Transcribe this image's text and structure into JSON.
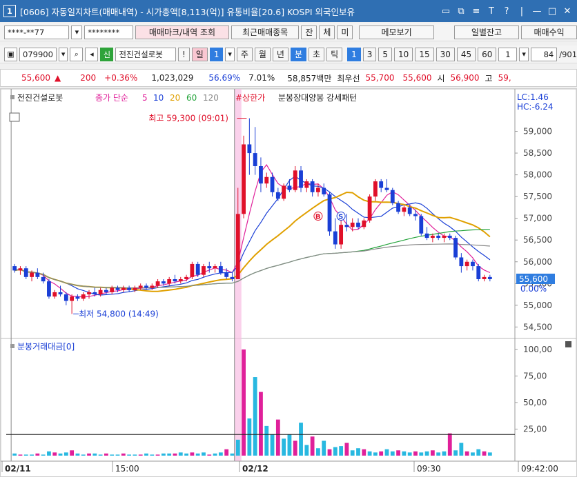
{
  "window": {
    "number": "1",
    "title": "[0606] 자동일지차트(매매내역) - 시가총액[8,113(억)] 유통비율[20.6] KOSPI 외국인보유",
    "controls": [
      "▭",
      "⧉",
      "≡",
      "T",
      "?",
      "|",
      "—",
      "□",
      "✕"
    ]
  },
  "toolbar1": {
    "account": "****-**77",
    "password": "********",
    "btn_trade_mark": "매매마크/내역 조회",
    "btn_recent": "최근매매종목",
    "btn_balance": "잔",
    "btn_fill": "체",
    "btn_unfilled": "미",
    "btn_memo": "메모보기",
    "btn_daily": "일별잔고",
    "btn_profit": "매매수익"
  },
  "toolbar2": {
    "code": "079900",
    "badge_new": "신",
    "stock_name": "전진건설로봇",
    "warn": "!",
    "day": "일",
    "day_count": "1",
    "periods": [
      "주",
      "월",
      "년"
    ],
    "minute": "분",
    "tick": "초",
    "tick2": "틱",
    "intervals": [
      "1",
      "3",
      "5",
      "10",
      "15",
      "30",
      "45",
      "60"
    ],
    "count_val": "1",
    "page_info": "84",
    "page_total": "/901"
  },
  "pricebar": {
    "price": "55,600",
    "arrow": "▲",
    "change": "200",
    "pct": "+0.36%",
    "volume": "1,023,029",
    "ratio1": "56.69%",
    "ratio2": "7.01%",
    "amount": "58,857백만",
    "best_label": "최우선",
    "ask": "55,700",
    "bid": "55,600",
    "open_label": "시",
    "open": "56,900",
    "high_label": "고",
    "high": "59,"
  },
  "chart_data": {
    "type": "candlestick",
    "legend": {
      "name": "전진건설로봇",
      "ma_label": "종가 단순",
      "ma_periods": [
        "5",
        "10",
        "20",
        "60",
        "120"
      ],
      "ma_colors": [
        "#e0209a",
        "#1a3fd6",
        "#e0a000",
        "#23a33a",
        "#888888"
      ],
      "limit_label": "#상한가",
      "pattern_label": "분봉장대양봉 강세패턴"
    },
    "lc": "LC:1.46",
    "hc": "HC:-6.24",
    "price_axis": [
      "59,000",
      "58,500",
      "58,000",
      "57,500",
      "57,000",
      "56,500",
      "56,000",
      "55,500",
      "55,000",
      "54,500"
    ],
    "current_price": "55,600",
    "current_pct": "0.00%",
    "high_note": "최고 59,300 (09:01)",
    "low_note": "최저 54,800 (14:49)",
    "candles": [
      {
        "o": 55900,
        "h": 55950,
        "l": 55750,
        "c": 55800
      },
      {
        "o": 55800,
        "h": 55900,
        "l": 55700,
        "c": 55850
      },
      {
        "o": 55850,
        "h": 55900,
        "l": 55600,
        "c": 55650
      },
      {
        "o": 55650,
        "h": 55800,
        "l": 55550,
        "c": 55750
      },
      {
        "o": 55750,
        "h": 55850,
        "l": 55600,
        "c": 55650
      },
      {
        "o": 55650,
        "h": 55750,
        "l": 55500,
        "c": 55550
      },
      {
        "o": 55550,
        "h": 55600,
        "l": 55150,
        "c": 55200
      },
      {
        "o": 55200,
        "h": 55350,
        "l": 55150,
        "c": 55300
      },
      {
        "o": 55300,
        "h": 55450,
        "l": 55200,
        "c": 55250
      },
      {
        "o": 55250,
        "h": 55300,
        "l": 55000,
        "c": 55100
      },
      {
        "o": 55100,
        "h": 55250,
        "l": 54800,
        "c": 55200
      },
      {
        "o": 55200,
        "h": 55250,
        "l": 55100,
        "c": 55150
      },
      {
        "o": 55150,
        "h": 55300,
        "l": 55100,
        "c": 55250
      },
      {
        "o": 55250,
        "h": 55350,
        "l": 55150,
        "c": 55300
      },
      {
        "o": 55300,
        "h": 55400,
        "l": 55200,
        "c": 55250
      },
      {
        "o": 55250,
        "h": 55400,
        "l": 55200,
        "c": 55350
      },
      {
        "o": 55350,
        "h": 55400,
        "l": 55250,
        "c": 55300
      },
      {
        "o": 55300,
        "h": 55450,
        "l": 55250,
        "c": 55400
      },
      {
        "o": 55400,
        "h": 55450,
        "l": 55300,
        "c": 55350
      },
      {
        "o": 55350,
        "h": 55450,
        "l": 55300,
        "c": 55400
      },
      {
        "o": 55400,
        "h": 55450,
        "l": 55300,
        "c": 55350
      },
      {
        "o": 55350,
        "h": 55450,
        "l": 55300,
        "c": 55400
      },
      {
        "o": 55400,
        "h": 55500,
        "l": 55350,
        "c": 55450
      },
      {
        "o": 55450,
        "h": 55500,
        "l": 55350,
        "c": 55400
      },
      {
        "o": 55400,
        "h": 55500,
        "l": 55350,
        "c": 55450
      },
      {
        "o": 55450,
        "h": 55600,
        "l": 55400,
        "c": 55550
      },
      {
        "o": 55550,
        "h": 55600,
        "l": 55450,
        "c": 55500
      },
      {
        "o": 55500,
        "h": 55650,
        "l": 55450,
        "c": 55600
      },
      {
        "o": 55600,
        "h": 55700,
        "l": 55500,
        "c": 55550
      },
      {
        "o": 55550,
        "h": 55650,
        "l": 55500,
        "c": 55600
      },
      {
        "o": 55600,
        "h": 55700,
        "l": 55550,
        "c": 55650
      },
      {
        "o": 55650,
        "h": 56000,
        "l": 55600,
        "c": 55950
      },
      {
        "o": 55950,
        "h": 56000,
        "l": 55650,
        "c": 55700
      },
      {
        "o": 55700,
        "h": 55950,
        "l": 55650,
        "c": 55900
      },
      {
        "o": 55900,
        "h": 56000,
        "l": 55750,
        "c": 55850
      },
      {
        "o": 55850,
        "h": 55950,
        "l": 55750,
        "c": 55900
      },
      {
        "o": 55900,
        "h": 56000,
        "l": 55700,
        "c": 55750
      },
      {
        "o": 55750,
        "h": 55850,
        "l": 55600,
        "c": 55650
      },
      {
        "o": 55650,
        "h": 55750,
        "l": 55550,
        "c": 55600
      },
      {
        "o": 55600,
        "h": 57700,
        "l": 55600,
        "c": 57100
      },
      {
        "o": 57100,
        "h": 58900,
        "l": 57000,
        "c": 58700
      },
      {
        "o": 58700,
        "h": 59300,
        "l": 58000,
        "c": 58500
      },
      {
        "o": 58500,
        "h": 59100,
        "l": 58000,
        "c": 58200
      },
      {
        "o": 58200,
        "h": 58400,
        "l": 57600,
        "c": 57800
      },
      {
        "o": 57800,
        "h": 58050,
        "l": 57700,
        "c": 57950
      },
      {
        "o": 57950,
        "h": 58050,
        "l": 57500,
        "c": 57600
      },
      {
        "o": 57600,
        "h": 57700,
        "l": 57400,
        "c": 57450
      },
      {
        "o": 57450,
        "h": 57800,
        "l": 57400,
        "c": 57750
      },
      {
        "o": 57750,
        "h": 57900,
        "l": 57600,
        "c": 57650
      },
      {
        "o": 57650,
        "h": 58200,
        "l": 57600,
        "c": 58100
      },
      {
        "o": 58100,
        "h": 58200,
        "l": 57600,
        "c": 57700
      },
      {
        "o": 57700,
        "h": 57900,
        "l": 57600,
        "c": 57850
      },
      {
        "o": 57850,
        "h": 57900,
        "l": 57500,
        "c": 57600
      },
      {
        "o": 57600,
        "h": 57800,
        "l": 57500,
        "c": 57700
      },
      {
        "o": 57700,
        "h": 57800,
        "l": 57500,
        "c": 57550
      },
      {
        "o": 57550,
        "h": 57600,
        "l": 56600,
        "c": 56700
      },
      {
        "o": 56700,
        "h": 57000,
        "l": 56300,
        "c": 56400
      },
      {
        "o": 56400,
        "h": 56950,
        "l": 56300,
        "c": 56850
      },
      {
        "o": 56850,
        "h": 57100,
        "l": 56700,
        "c": 56800
      },
      {
        "o": 56800,
        "h": 57000,
        "l": 56700,
        "c": 56900
      },
      {
        "o": 56900,
        "h": 57000,
        "l": 56750,
        "c": 56800
      },
      {
        "o": 56800,
        "h": 57000,
        "l": 56750,
        "c": 56950
      },
      {
        "o": 56950,
        "h": 57550,
        "l": 56900,
        "c": 57500
      },
      {
        "o": 57500,
        "h": 57900,
        "l": 57400,
        "c": 57850
      },
      {
        "o": 57850,
        "h": 57900,
        "l": 57600,
        "c": 57700
      },
      {
        "o": 57700,
        "h": 57900,
        "l": 57600,
        "c": 57650
      },
      {
        "o": 57650,
        "h": 57700,
        "l": 57300,
        "c": 57350
      },
      {
        "o": 57350,
        "h": 57400,
        "l": 57100,
        "c": 57150
      },
      {
        "o": 57150,
        "h": 57300,
        "l": 57050,
        "c": 57250
      },
      {
        "o": 57250,
        "h": 57300,
        "l": 57050,
        "c": 57100
      },
      {
        "o": 57100,
        "h": 57200,
        "l": 56950,
        "c": 57050
      },
      {
        "o": 57050,
        "h": 57100,
        "l": 56600,
        "c": 56650
      },
      {
        "o": 56650,
        "h": 56800,
        "l": 56500,
        "c": 56550
      },
      {
        "o": 56550,
        "h": 56650,
        "l": 56450,
        "c": 56600
      },
      {
        "o": 56600,
        "h": 56650,
        "l": 56500,
        "c": 56550
      },
      {
        "o": 56550,
        "h": 56650,
        "l": 56450,
        "c": 56600
      },
      {
        "o": 56600,
        "h": 56650,
        "l": 56500,
        "c": 56550
      },
      {
        "o": 56550,
        "h": 56600,
        "l": 56050,
        "c": 56100
      },
      {
        "o": 56100,
        "h": 56200,
        "l": 55750,
        "c": 55900
      },
      {
        "o": 55900,
        "h": 56050,
        "l": 55800,
        "c": 56000
      },
      {
        "o": 56000,
        "h": 56050,
        "l": 55800,
        "c": 55900
      },
      {
        "o": 55900,
        "h": 55950,
        "l": 55550,
        "c": 55600
      },
      {
        "o": 55600,
        "h": 55700,
        "l": 55550,
        "c": 55650
      },
      {
        "o": 55650,
        "h": 55700,
        "l": 55550,
        "c": 55600
      }
    ],
    "volume_panel": {
      "label": "분봉거래대금[0]",
      "axis": [
        "100,00",
        "75,00",
        "50,00",
        "25,00"
      ],
      "threshold": 20,
      "values": [
        2,
        1,
        1,
        1,
        2,
        1,
        4,
        3,
        2,
        3,
        5,
        2,
        1,
        2,
        2,
        1,
        2,
        1,
        1,
        2,
        1,
        1,
        1,
        2,
        1,
        1,
        2,
        2,
        2,
        3,
        2,
        3,
        2,
        3,
        1,
        2,
        3,
        6,
        2,
        15,
        100,
        35,
        74,
        60,
        28,
        20,
        34,
        16,
        20,
        14,
        31,
        10,
        18,
        7,
        14,
        6,
        8,
        9,
        12,
        5,
        7,
        6,
        4,
        3,
        4,
        6,
        4,
        5,
        4,
        3,
        4,
        3,
        4,
        5,
        3,
        4,
        21,
        5,
        12,
        4,
        3,
        6,
        4,
        3
      ]
    },
    "x_labels": [
      "02/11",
      "15:00",
      "02/12",
      "09:30",
      "09:42:00"
    ],
    "marks": [
      "B",
      "S"
    ]
  }
}
